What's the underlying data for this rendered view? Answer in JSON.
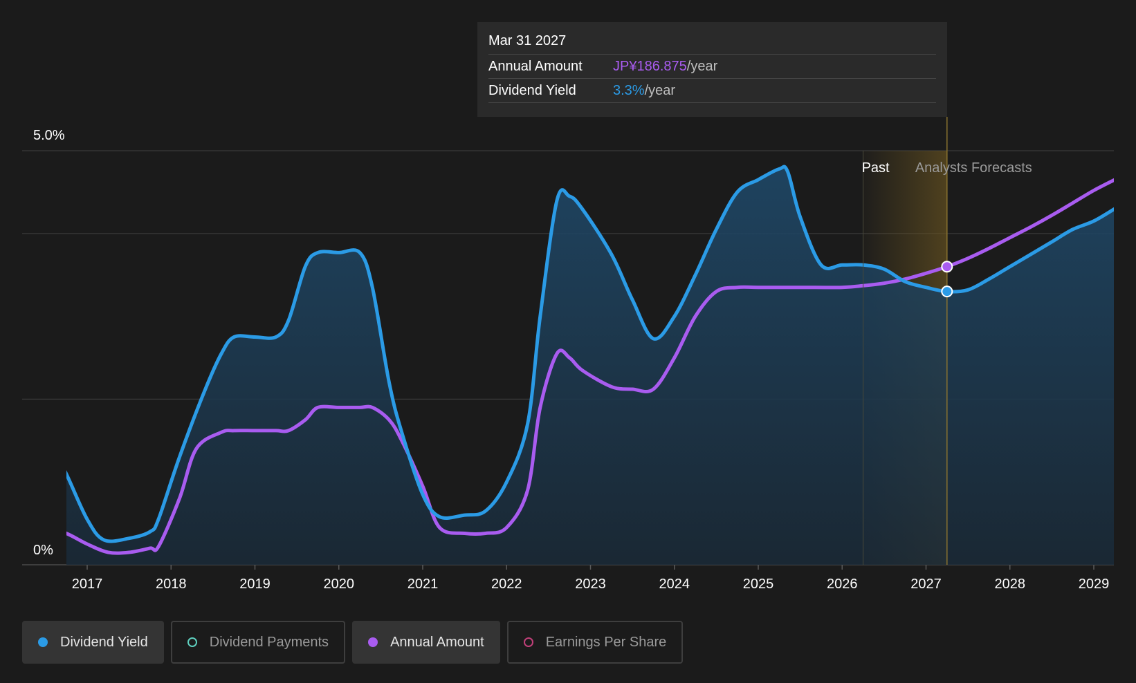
{
  "tooltip": {
    "date": "Mar 31 2027",
    "annual_label": "Annual Amount",
    "annual_value": "JP¥186.875",
    "annual_unit": "/year",
    "yield_label": "Dividend Yield",
    "yield_value": "3.3%",
    "yield_unit": "/year"
  },
  "legend": [
    {
      "label": "Dividend Yield",
      "color": "#2b9be6",
      "active": true,
      "filled": true
    },
    {
      "label": "Dividend Payments",
      "color": "#5fd1c0",
      "active": false,
      "filled": false
    },
    {
      "label": "Annual Amount",
      "color": "#a95cf0",
      "active": true,
      "filled": true
    },
    {
      "label": "Earnings Per Share",
      "color": "#c2407a",
      "active": false,
      "filled": false
    }
  ],
  "colors": {
    "yield": "#2b9be6",
    "annual": "#a95cf0",
    "forecast_band": "#6b5520",
    "background": "#1b1b1b"
  },
  "chart_data": {
    "type": "line",
    "y_tick_labels": [
      "5.0%",
      "0%"
    ],
    "ylim": [
      0,
      5.0
    ],
    "xlim": [
      2016.75,
      2029.25
    ],
    "x_tick_labels": [
      "2017",
      "2018",
      "2019",
      "2020",
      "2021",
      "2022",
      "2023",
      "2024",
      "2025",
      "2026",
      "2027",
      "2028",
      "2029"
    ],
    "x_ticks": [
      2017,
      2018,
      2019,
      2020,
      2021,
      2022,
      2023,
      2024,
      2025,
      2026,
      2027,
      2028,
      2029
    ],
    "grid": true,
    "past_label": "Past",
    "forecast_label": "Analysts Forecasts",
    "past_forecast_boundary": 2026.25,
    "highlight_x": 2027.25,
    "series": [
      {
        "name": "Dividend Yield",
        "key": "yield",
        "area": true,
        "x": [
          2016.5,
          2016.75,
          2017.0,
          2017.2,
          2017.5,
          2017.75,
          2017.85,
          2018.1,
          2018.4,
          2018.6,
          2018.75,
          2019.0,
          2019.25,
          2019.4,
          2019.6,
          2019.75,
          2020.0,
          2020.25,
          2020.4,
          2020.6,
          2020.75,
          2021.0,
          2021.2,
          2021.5,
          2021.75,
          2022.0,
          2022.25,
          2022.4,
          2022.6,
          2022.75,
          2022.9,
          2023.25,
          2023.5,
          2023.75,
          2024.0,
          2024.25,
          2024.5,
          2024.75,
          2025.0,
          2025.25,
          2025.35,
          2025.5,
          2025.75,
          2026.0,
          2026.25,
          2026.5,
          2026.75,
          2027.0,
          2027.25,
          2027.5,
          2027.75,
          2028.0,
          2028.25,
          2028.5,
          2028.75,
          2029.0,
          2029.25
        ],
        "y": [
          1.6,
          1.1,
          0.55,
          0.3,
          0.32,
          0.4,
          0.55,
          1.3,
          2.1,
          2.55,
          2.75,
          2.75,
          2.75,
          2.95,
          3.6,
          3.77,
          3.77,
          3.77,
          3.35,
          2.2,
          1.6,
          0.85,
          0.58,
          0.6,
          0.65,
          1.0,
          1.7,
          3.0,
          4.4,
          4.45,
          4.3,
          3.75,
          3.2,
          2.73,
          3.0,
          3.5,
          4.05,
          4.5,
          4.65,
          4.78,
          4.75,
          4.2,
          3.62,
          3.62,
          3.62,
          3.57,
          3.42,
          3.35,
          3.3,
          3.32,
          3.45,
          3.6,
          3.75,
          3.9,
          4.05,
          4.15,
          4.3
        ]
      },
      {
        "name": "Annual Amount",
        "key": "annual",
        "area": false,
        "x": [
          2016.5,
          2016.75,
          2017.0,
          2017.25,
          2017.5,
          2017.75,
          2017.85,
          2018.1,
          2018.3,
          2018.6,
          2018.75,
          2019.0,
          2019.25,
          2019.4,
          2019.6,
          2019.75,
          2020.0,
          2020.25,
          2020.4,
          2020.6,
          2020.75,
          2021.0,
          2021.2,
          2021.5,
          2021.75,
          2022.0,
          2022.25,
          2022.4,
          2022.6,
          2022.75,
          2022.9,
          2023.25,
          2023.5,
          2023.75,
          2024.0,
          2024.25,
          2024.5,
          2024.75,
          2025.0,
          2025.5,
          2026.0,
          2026.25,
          2026.5,
          2026.75,
          2027.0,
          2027.25,
          2027.5,
          2027.75,
          2028.0,
          2028.25,
          2028.5,
          2028.75,
          2029.0,
          2029.25
        ],
        "y": [
          0.45,
          0.38,
          0.25,
          0.15,
          0.15,
          0.2,
          0.22,
          0.8,
          1.4,
          1.6,
          1.62,
          1.62,
          1.62,
          1.62,
          1.75,
          1.9,
          1.9,
          1.9,
          1.9,
          1.75,
          1.5,
          0.95,
          0.45,
          0.38,
          0.38,
          0.45,
          0.9,
          1.9,
          2.55,
          2.5,
          2.35,
          2.15,
          2.12,
          2.12,
          2.5,
          3.0,
          3.3,
          3.35,
          3.35,
          3.35,
          3.35,
          3.37,
          3.4,
          3.45,
          3.52,
          3.6,
          3.7,
          3.82,
          3.95,
          4.08,
          4.22,
          4.37,
          4.52,
          4.65
        ]
      }
    ],
    "highlight_points": [
      {
        "series": "Annual Amount",
        "x": 2027.25,
        "y": 3.6
      },
      {
        "series": "Dividend Yield",
        "x": 2027.25,
        "y": 3.3
      }
    ]
  }
}
